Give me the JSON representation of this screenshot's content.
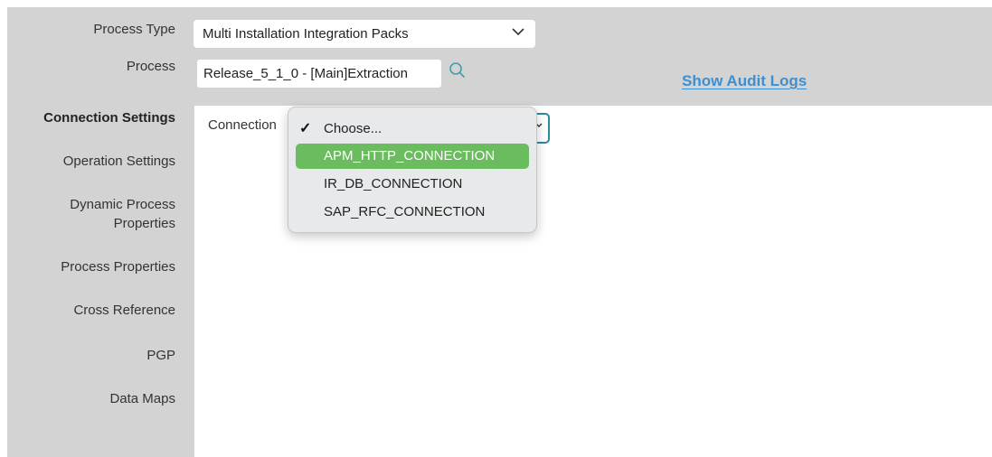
{
  "header": {
    "process_type_label": "Process Type",
    "process_type_value": "Multi Installation Integration Packs",
    "process_label": "Process",
    "process_value": "Release_5_1_0 - [Main]Extraction",
    "audit_link": "Show Audit Logs"
  },
  "sidebar": {
    "items": [
      {
        "label": "Connection Settings"
      },
      {
        "label": "Operation Settings"
      },
      {
        "label": "Dynamic Process"
      },
      {
        "label": "Properties"
      },
      {
        "label": "Process Properties"
      },
      {
        "label": "Cross Reference"
      },
      {
        "label": "PGP"
      },
      {
        "label": "Data Maps"
      }
    ]
  },
  "main": {
    "connection_label": "Connection",
    "dropdown": {
      "options": [
        {
          "label": "Choose...",
          "checked": true
        },
        {
          "label": "APM_HTTP_CONNECTION",
          "highlighted": true
        },
        {
          "label": "IR_DB_CONNECTION"
        },
        {
          "label": "SAP_RFC_CONNECTION"
        }
      ]
    }
  },
  "colors": {
    "background": "#d3d3d3",
    "link": "#3d8fd1",
    "highlight": "#6bbb5f",
    "focus_border": "#2a8a9a"
  }
}
